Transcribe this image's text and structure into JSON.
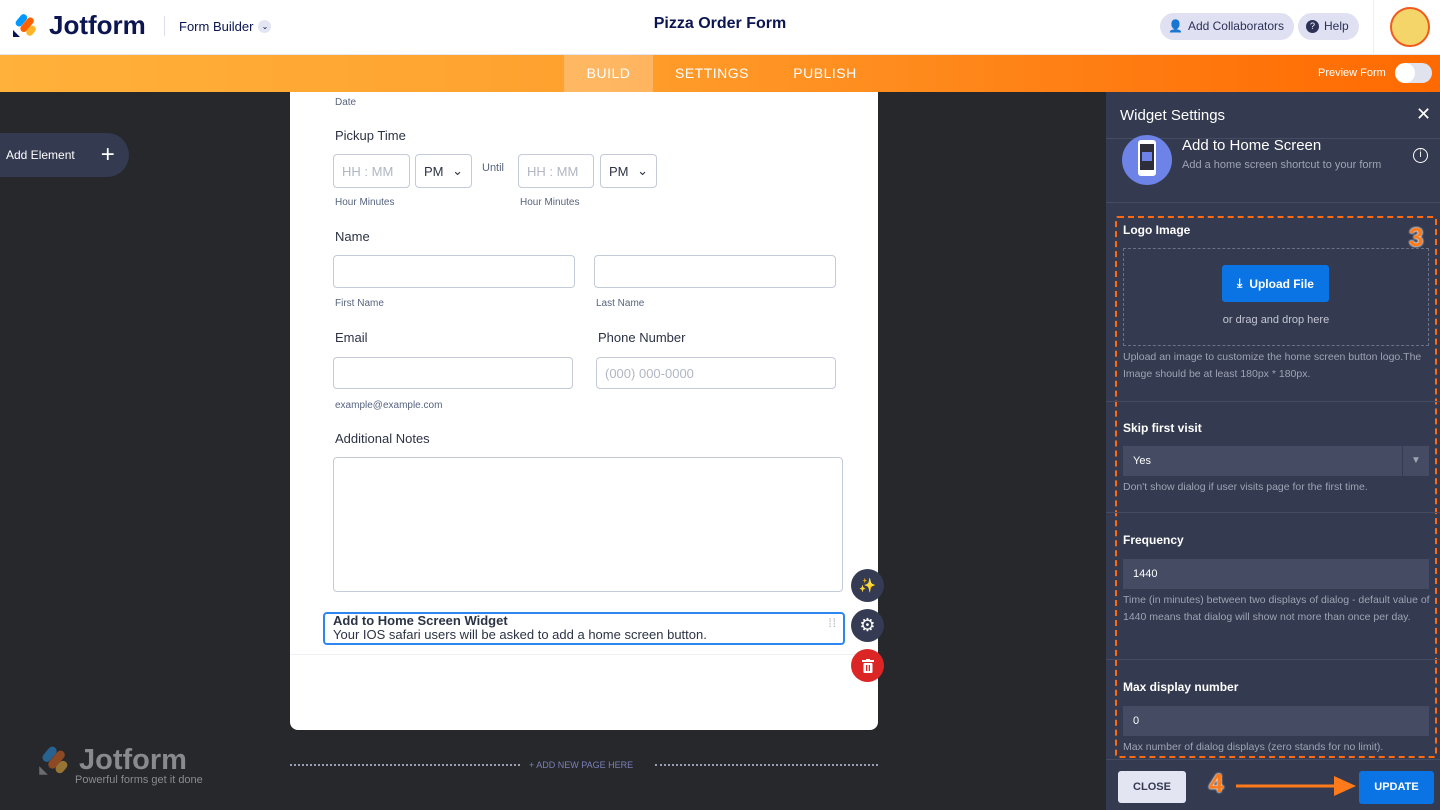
{
  "header": {
    "brand": "Jotform",
    "product": "Form Builder",
    "title": "Pizza Order Form",
    "add_collaborators": "Add Collaborators",
    "help": "Help"
  },
  "nav": {
    "tabs": [
      "BUILD",
      "SETTINGS",
      "PUBLISH"
    ],
    "active": "BUILD",
    "preview_label": "Preview Form",
    "preview_on": false
  },
  "left": {
    "add_element": "Add Element",
    "footer_brand": "Jotform",
    "footer_tagline": "Powerful forms get it done",
    "add_page": "+ ADD NEW PAGE HERE"
  },
  "form": {
    "date_sublabel": "Date",
    "pickup_label": "Pickup Time",
    "time_placeholder": "HH : MM",
    "ampm": "PM",
    "until": "Until",
    "hour_minutes": "Hour Minutes",
    "name_label": "Name",
    "first_name": "First Name",
    "last_name": "Last Name",
    "email_label": "Email",
    "email_sublabel": "example@example.com",
    "phone_label": "Phone Number",
    "phone_placeholder": "(000) 000-0000",
    "notes_label": "Additional Notes",
    "widget_title": "Add to Home Screen Widget",
    "widget_desc": "Your IOS safari users will be asked to add a home screen button."
  },
  "panel": {
    "title": "Widget Settings",
    "widget_name": "Add to Home Screen",
    "widget_subtitle": "Add a home screen shortcut to your form",
    "logo_label": "Logo Image",
    "upload": "Upload File",
    "drag": "or drag and drop here",
    "logo_help": "Upload an image to customize the home screen button logo.The Image should be at least 180px * 180px.",
    "skip_label": "Skip first visit",
    "skip_value": "Yes",
    "skip_help": "Don't show dialog if user visits page for the first time.",
    "freq_label": "Frequency",
    "freq_value": "1440",
    "freq_help": "Time (in minutes) between two displays of dialog - default value of 1440 means that dialog will show not more than once per day.",
    "max_label": "Max display number",
    "max_value": "0",
    "max_help": "Max number of dialog displays (zero stands for no limit).",
    "close": "CLOSE",
    "update": "UPDATE",
    "step3": "3",
    "step4": "4"
  },
  "colors": {
    "accent": "#ff6100",
    "blue": "#0a74e4",
    "panel": "#343a4f"
  }
}
